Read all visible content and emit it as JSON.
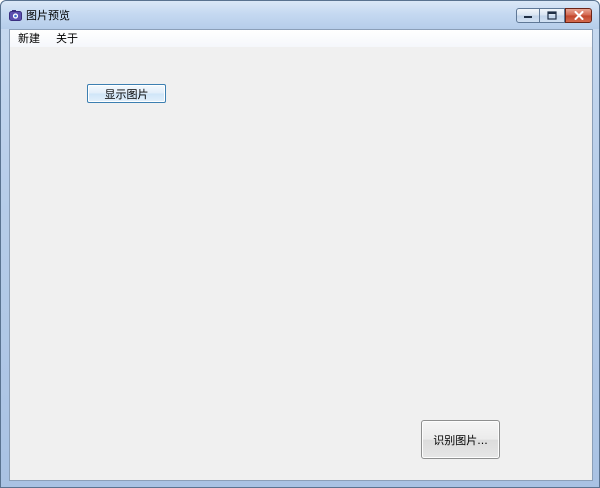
{
  "window": {
    "title": "图片预览",
    "icon": "camera-app-icon"
  },
  "titlebar_buttons": {
    "minimize": "minimize-icon",
    "maximize": "maximize-icon",
    "close": "close-icon"
  },
  "menu": {
    "items": [
      {
        "label": "新建"
      },
      {
        "label": "关于"
      }
    ]
  },
  "main": {
    "show_image_label": "显示图片",
    "recognize_image_label": "识别图片..."
  },
  "colors": {
    "titlebar": "#c5d9f1",
    "client_bg": "#f0f0f0",
    "close_button": "#c1452b",
    "focus_border": "#3c7fb1"
  }
}
